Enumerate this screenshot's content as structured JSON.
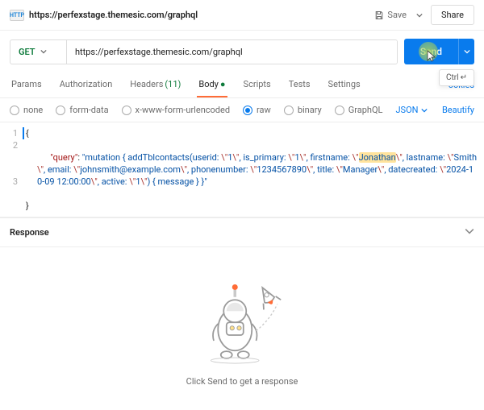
{
  "top": {
    "badge": "HTTP",
    "url": "https://perfexstage.themesic.com/graphql",
    "save": "Save",
    "share": "Share"
  },
  "request": {
    "method": "GET",
    "url": "https://perfexstage.themesic.com/graphql",
    "send": "Send",
    "shortcut_key": "Ctrl",
    "shortcut_icon": "↵"
  },
  "tabs": {
    "items": [
      {
        "label": "Params"
      },
      {
        "label": "Authorization"
      },
      {
        "label": "Headers",
        "count": "(11)"
      },
      {
        "label": "Body",
        "active": true,
        "dot": "●"
      },
      {
        "label": "Scripts"
      },
      {
        "label": "Tests"
      },
      {
        "label": "Settings"
      }
    ],
    "cookies": "ookies"
  },
  "body_opts": {
    "items": [
      {
        "label": "none"
      },
      {
        "label": "form-data"
      },
      {
        "label": "x-www-form-urlencoded"
      },
      {
        "label": "raw",
        "checked": true
      },
      {
        "label": "binary"
      },
      {
        "label": "GraphQL"
      }
    ],
    "format": "JSON",
    "beautify": "Beautify"
  },
  "editor": {
    "lines": [
      "1",
      "2",
      "3"
    ],
    "l1": "{",
    "key": "\"query\"",
    "colon": ": ",
    "qo": "\"",
    "s1": "mutation { addTblcontacts(userid: ",
    "e1": "\\\"",
    "s2": "1",
    "e2": "\\\"",
    "s3": ", is_primary: ",
    "e3": "\\\"",
    "s4": "1",
    "e4": "\\\"",
    "s5": ", firstname: ",
    "e5": "\\\"",
    "s6": "Jonathan",
    "e6": "\\\"",
    "s7": ", lastname: ",
    "e7": "\\\"",
    "s8": "Smith",
    "e8": "\\\"",
    "s9": ", email: ",
    "e9": "\\\"",
    "s10": "johnsmith@example.com",
    "e10": "\\\"",
    "s11": ", phonenumber: ",
    "e11": "\\\"",
    "s12": "1234567890",
    "e12": "\\\"",
    "s13": ", title: ",
    "e13": "\\\"",
    "s14": "Manager",
    "e14": "\\\"",
    "s15": ", datecreated: ",
    "e15": "\\\"",
    "s16": "2024-10-09 12:00:00",
    "e16": "\\\"",
    "s17": ", active: ",
    "e17": "\\\"",
    "s18": "1",
    "e18": "\\\"",
    "s19": ") { message } }",
    "qc": "\"",
    "l3": "}"
  },
  "response": {
    "title": "Response",
    "empty": "Click Send to get a response"
  }
}
